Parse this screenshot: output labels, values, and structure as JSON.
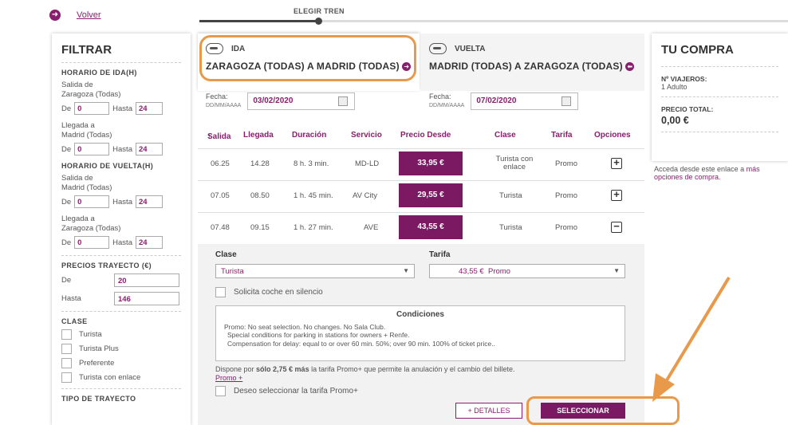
{
  "top": {
    "back_label": "Volver",
    "step_label": "ELEGIR TREN"
  },
  "filter": {
    "title": "FILTRAR",
    "ida_heading": "HORARIO DE IDA(H)",
    "ida_salida": "Salida de\nZaragoza (Todas)",
    "ida_llegada": "Llegada a\nMadrid (Todas)",
    "vuelta_heading": "HORARIO DE VUELTA(H)",
    "vuelta_salida": "Salida de\nMadrid (Todas)",
    "vuelta_llegada": "Llegada a\nZaragoza (Todas)",
    "de": "De",
    "hasta": "Hasta",
    "from_val": "0",
    "to_val": "24",
    "precios_heading": "PRECIOS TRAYECTO (€)",
    "precio_de_label": "De",
    "precio_de": "20",
    "precio_hasta_label": "Hasta",
    "precio_hasta": "146",
    "clase_heading": "CLASE",
    "clases": [
      "Turista",
      "Turista Plus",
      "Preferente",
      "Turista con enlace"
    ],
    "tipo_heading": "TIPO DE TRAYECTO"
  },
  "tabs": {
    "ida": {
      "label": "IDA",
      "route": "ZARAGOZA (TODAS) A MADRID (TODAS)",
      "fecha_label": "Fecha:",
      "fecha_hint": "DD/MM/AAAA",
      "fecha": "03/02/2020"
    },
    "vuelta": {
      "label": "VUELTA",
      "route": "MADRID (TODAS) A ZARAGOZA (TODAS)",
      "fecha_label": "Fecha:",
      "fecha_hint": "DD/MM/AAAA",
      "fecha": "07/02/2020"
    }
  },
  "table": {
    "headers": {
      "salida": "Salida",
      "llegada": "Llegada",
      "duracion": "Duración",
      "servicio": "Servicio",
      "precio": "Precio Desde",
      "clase": "Clase",
      "tarifa": "Tarifa",
      "opciones": "Opciones"
    },
    "rows": [
      {
        "salida": "06.25",
        "llegada": "14.28",
        "duracion": "8 h. 3 min.",
        "servicio": "MD-LD",
        "precio": "33,95 €",
        "clase": "Turista con enlace",
        "tarifa": "Promo",
        "opt": "+"
      },
      {
        "salida": "07.05",
        "llegada": "08.50",
        "duracion": "1 h. 45 min.",
        "servicio": "AV City",
        "precio": "29,55 €",
        "clase": "Turista",
        "tarifa": "Promo",
        "opt": "+"
      },
      {
        "salida": "07.48",
        "llegada": "09.15",
        "duracion": "1 h. 27 min.",
        "servicio": "AVE",
        "precio": "43,55 €",
        "clase": "Turista",
        "tarifa": "Promo",
        "opt": "−"
      }
    ]
  },
  "detail": {
    "clase_label": "Clase",
    "clase_value": "Turista",
    "tarifa_label": "Tarifa",
    "tarifa_price": "43,55 €",
    "tarifa_value": "Promo",
    "silencio": "Solicita coche en silencio",
    "cond_title": "Condiciones",
    "cond_1": "Promo:  No seat selection.  No changes.  No Sala Club.",
    "cond_2": "Special conditions for parking in stations for owners + Renfe.",
    "cond_3": "Compensation for delay: equal to or over 60 min. 50%; over 90 min. 100% of ticket price..",
    "promo_pre": "Dispone por ",
    "promo_bold": "sólo 2,75 € más",
    "promo_post": " la tarifa Promo+ que permite la anulación y el cambio del billete.",
    "promo_link": "Promo +",
    "promo_check": "Deseo seleccionar la tarifa Promo+",
    "btn_detalles": "+ DETALLES",
    "btn_seleccionar": "SELECCIONAR"
  },
  "cart": {
    "title": "TU COMPRA",
    "viajeros_label": "Nº VIAJEROS:",
    "viajeros": "1 Adulto",
    "total_label": "PRECIO TOTAL:",
    "total": "0,00 €",
    "note": "Acceda desde este enlace a ",
    "note_link": "más opciones de compra."
  },
  "colors": {
    "accent": "#7b1a63",
    "annotation": "#e8994a"
  }
}
